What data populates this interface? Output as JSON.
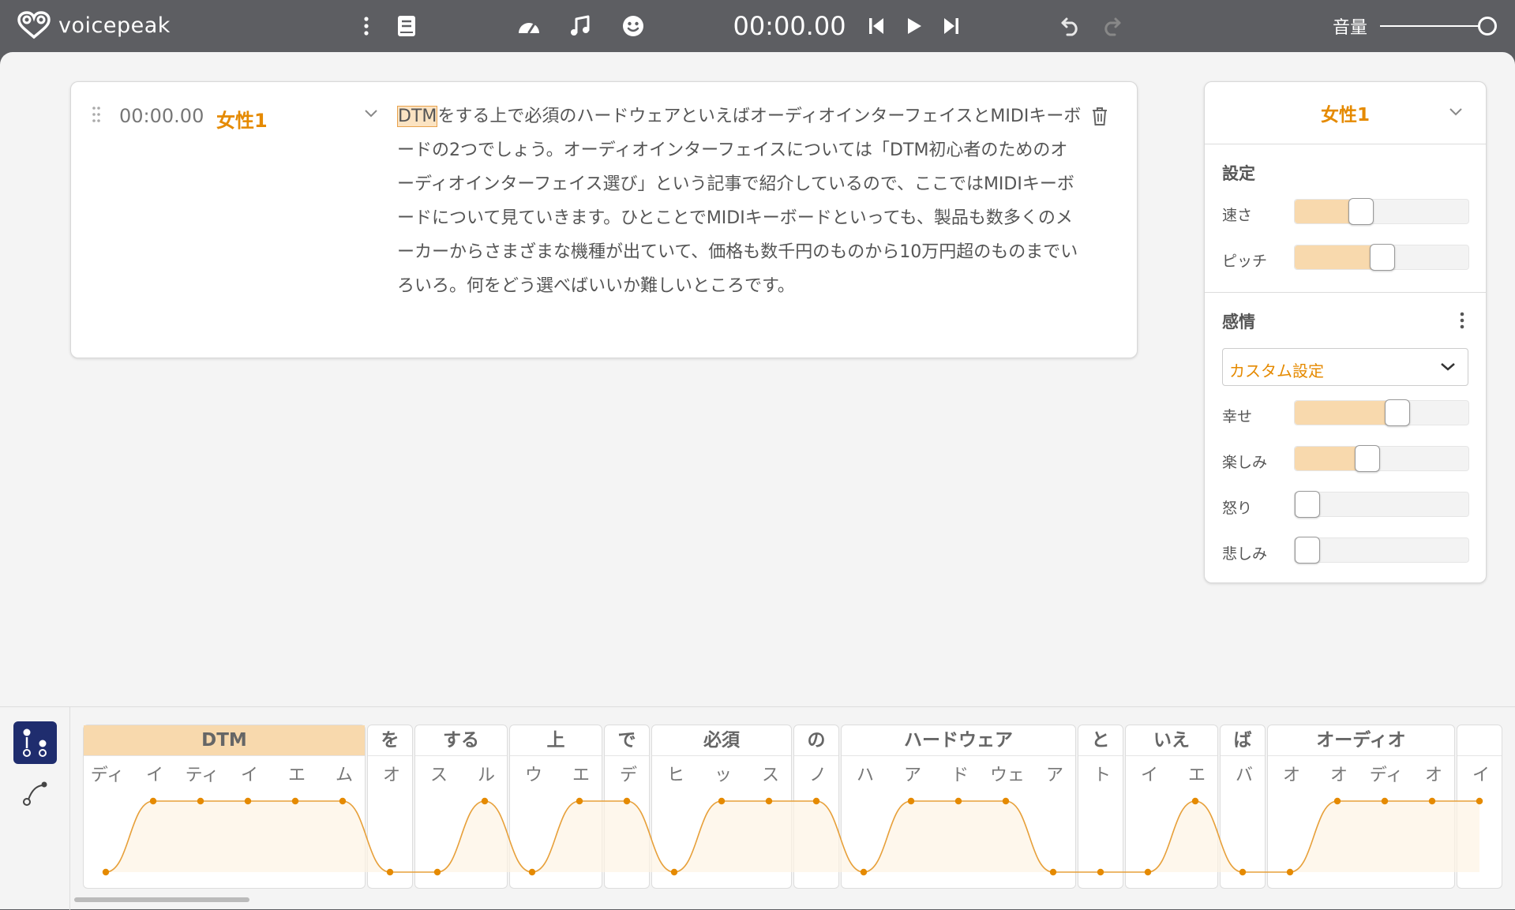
{
  "app": {
    "name": "voicepeak"
  },
  "toolbar": {
    "time": "00:00.00",
    "volume_label": "音量",
    "volume_value": 1.0
  },
  "block": {
    "time": "00:00.00",
    "speaker": "女性1",
    "highlight": "DTM",
    "text": "をする上で必須のハードウェアといえばオーディオインターフェイスとMIDIキーボードの2つでしょう。オーディオインターフェイスについては「DTM初心者のためのオーディオインターフェイス選び」という記事で紹介しているので、ここではMIDIキーボードについて見ていきます。ひとことでMIDIキーボードといっても、製品も数多くのメーカーからさまざまな機種が出ていて、価格も数千円のものから10万円超のものまでいろいろ。何をどう選べばいいか難しいところです。"
  },
  "panel": {
    "speaker": "女性1",
    "settings_title": "設定",
    "settings": [
      {
        "label": "速さ",
        "value": 0.36
      },
      {
        "label": "ピッチ",
        "value": 0.5
      }
    ],
    "emotion_title": "感情",
    "emotion_preset": "カスタム設定",
    "emotions": [
      {
        "label": "幸せ",
        "value": 0.6
      },
      {
        "label": "楽しみ",
        "value": 0.4
      },
      {
        "label": "怒り",
        "value": 0
      },
      {
        "label": "悲しみ",
        "value": 0
      }
    ]
  },
  "timeline": {
    "words": [
      {
        "label": "DTM",
        "moras": [
          "ディ",
          "イ",
          "ティ",
          "イ",
          "エ",
          "ム"
        ],
        "selected": true
      },
      {
        "label": "を",
        "moras": [
          "オ"
        ]
      },
      {
        "label": "する",
        "moras": [
          "ス",
          "ル"
        ]
      },
      {
        "label": "上",
        "moras": [
          "ウ",
          "エ"
        ]
      },
      {
        "label": "で",
        "moras": [
          "デ"
        ]
      },
      {
        "label": "必須",
        "moras": [
          "ヒ",
          "ッ",
          "ス"
        ]
      },
      {
        "label": "の",
        "moras": [
          "ノ"
        ]
      },
      {
        "label": "ハードウェア",
        "moras": [
          "ハ",
          "ア",
          "ド",
          "ウェ",
          "ア"
        ]
      },
      {
        "label": "と",
        "moras": [
          "ト"
        ]
      },
      {
        "label": "いえ",
        "moras": [
          "イ",
          "エ"
        ]
      },
      {
        "label": "ば",
        "moras": [
          "バ"
        ]
      },
      {
        "label": "オーディオ",
        "moras": [
          "オ",
          "オ",
          "ディ",
          "オ"
        ]
      },
      {
        "label": "",
        "moras": [
          "イ"
        ]
      }
    ],
    "accent": [
      0,
      1,
      1,
      1,
      1,
      1,
      0,
      0,
      1,
      0,
      1,
      1,
      0,
      1,
      1,
      1,
      0,
      1,
      1,
      1,
      0,
      0,
      0,
      1,
      0,
      0,
      1,
      1,
      1,
      1
    ]
  }
}
